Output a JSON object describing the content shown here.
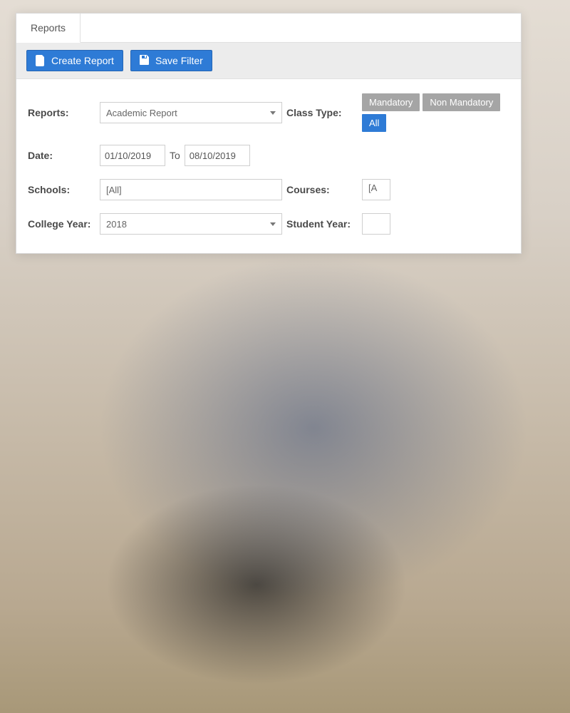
{
  "tab": {
    "label": "Reports"
  },
  "toolbar": {
    "create_report": "Create Report",
    "save_filter": "Save Filter"
  },
  "form": {
    "reports_label": "Reports:",
    "reports_value": "Academic Report",
    "class_type_label": "Class Type:",
    "class_type_options": {
      "mandatory": "Mandatory",
      "non_mandatory": "Non Mandatory",
      "all": "All"
    },
    "date_label": "Date:",
    "date_from": "01/10/2019",
    "date_to_label": "To",
    "date_to": "08/10/2019",
    "schools_label": "Schools:",
    "schools_value": "[All]",
    "courses_label": "Courses:",
    "courses_value": "[A",
    "college_year_label": "College Year:",
    "college_year_value": "2018",
    "student_year_label": "Student Year:"
  }
}
